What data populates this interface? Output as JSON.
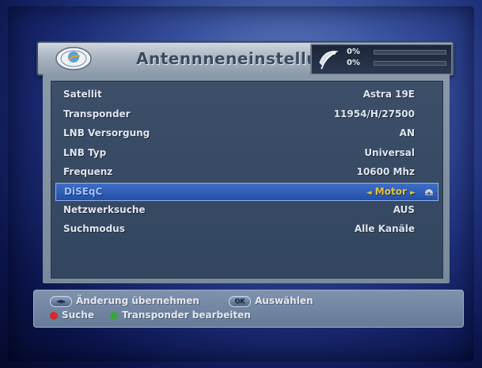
{
  "header": {
    "title": "Antennneneinstellunge",
    "signal": {
      "strength": "0%",
      "quality": "0%",
      "strength_level": 0,
      "quality_level": 0
    }
  },
  "settings": [
    {
      "label": "Satellit",
      "value": "Astra 19E"
    },
    {
      "label": "Transponder",
      "value": "11954/H/27500"
    },
    {
      "label": "LNB Versorgung",
      "value": "AN"
    },
    {
      "label": "LNB Typ",
      "value": "Universal"
    },
    {
      "label": "Frequenz",
      "value": "10600 Mhz"
    },
    {
      "label": "DiSEqC",
      "value": "Motor",
      "selected": true,
      "left_arrow": "◄",
      "right_arrow": "►"
    },
    {
      "label": "Netzwerksuche",
      "value": "AUS"
    },
    {
      "label": "Suchmodus",
      "value": "Alle Kanäle"
    }
  ],
  "footer": {
    "change_key": "◄►",
    "change_label": "Änderung übernehmen",
    "ok_key": "OK",
    "ok_label": "Auswählen",
    "red_label": "Suche",
    "green_label": "Transponder bearbeiten",
    "red_color": "#d42a2a",
    "green_color": "#3aa63a"
  },
  "colors": {
    "accent": "#2450a6",
    "value_highlight": "#e5c23a"
  }
}
